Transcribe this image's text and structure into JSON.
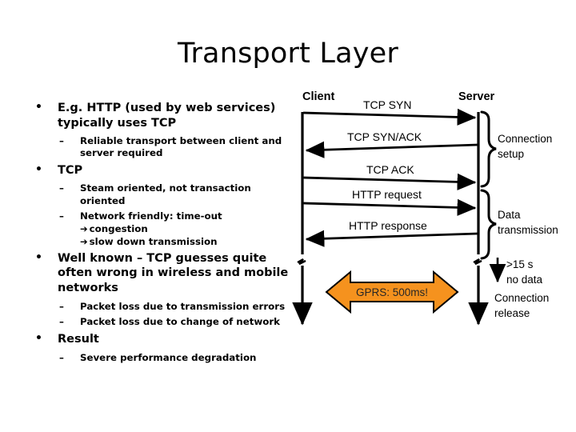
{
  "slide": {
    "title": "Transport Layer"
  },
  "bullets": [
    {
      "level": 1,
      "marker": "•",
      "text": "E.g. HTTP (used by web services) typically uses TCP"
    },
    {
      "level": 2,
      "marker": "–",
      "text": "Reliable transport between client and server required"
    },
    {
      "level": 1,
      "marker": "•",
      "text": "TCP"
    },
    {
      "level": 2,
      "marker": "–",
      "text": "Steam oriented, not transaction oriented"
    },
    {
      "level": 2,
      "marker": "–",
      "text": "Network friendly: time-out"
    },
    {
      "level": 3,
      "marker": "➔",
      "text": "congestion"
    },
    {
      "level": 3,
      "marker": "➔",
      "text": "slow down transmission"
    },
    {
      "level": 1,
      "marker": "•",
      "text": "Well known – TCP guesses quite often wrong in wireless and mobile networks"
    },
    {
      "level": 2,
      "marker": "–",
      "text": "Packet loss due to transmission errors"
    },
    {
      "level": 2,
      "marker": "–",
      "text": "Packet loss due to change of network"
    },
    {
      "level": 1,
      "marker": "•",
      "text": "Result"
    },
    {
      "level": 2,
      "marker": "–",
      "text": "Severe performance degradation"
    }
  ],
  "diagram": {
    "actors": {
      "client": "Client",
      "server": "Server"
    },
    "messages": [
      {
        "label": "TCP SYN",
        "direction": "right"
      },
      {
        "label": "TCP SYN/ACK",
        "direction": "left"
      },
      {
        "label": "TCP ACK",
        "direction": "right"
      },
      {
        "label": "HTTP request",
        "direction": "right"
      },
      {
        "label": "HTTP response",
        "direction": "left"
      }
    ],
    "braces": [
      {
        "label_line1": "Connection",
        "label_line2": "setup"
      },
      {
        "label_line1": "Data",
        "label_line2": "transmission"
      }
    ],
    "timeout": {
      "line1": ">15 s",
      "line2": "no data",
      "result_line1": "Connection",
      "result_line2": "release"
    },
    "callout": {
      "label": "GPRS: 500ms!",
      "fill": "#F5921E",
      "stroke": "#000000",
      "text_color": "#262626"
    }
  }
}
